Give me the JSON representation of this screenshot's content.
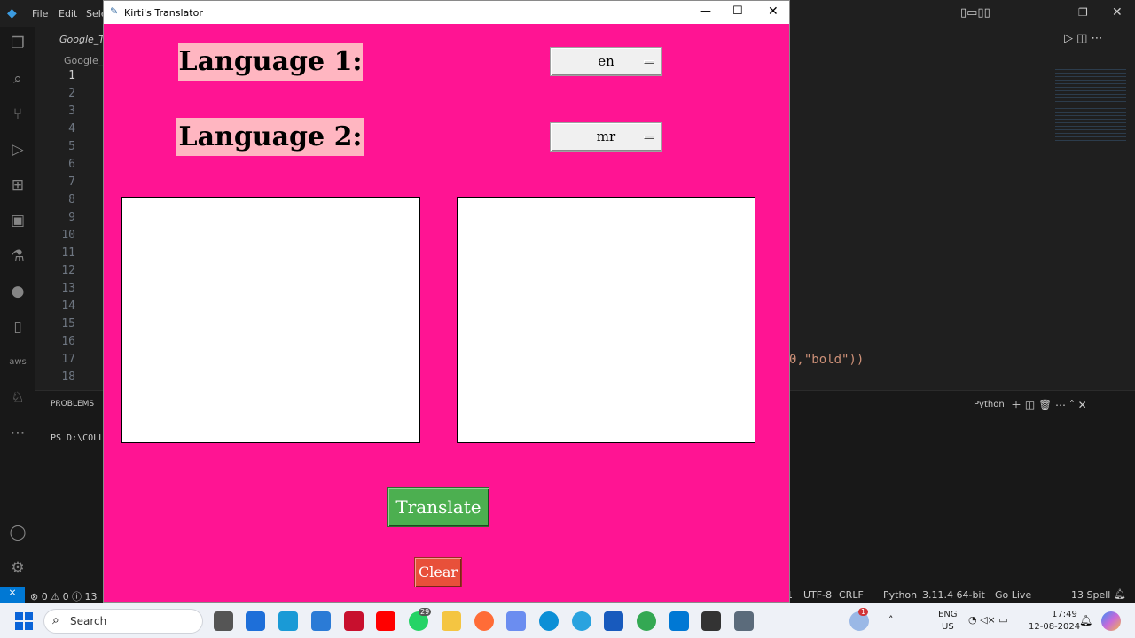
{
  "vscode": {
    "menu": [
      "File",
      "Edit",
      "Sele"
    ],
    "tab1": "Google_Tra",
    "tab2": "Google_Tr",
    "line_numbers": [
      "1",
      "2",
      "3",
      "4",
      "5",
      "6",
      "7",
      "8",
      "9",
      "10",
      "11",
      "12",
      "13",
      "14",
      "15",
      "16",
      "17",
      "18"
    ],
    "code_snippet": "0,\"bold\"))",
    "panel_tab": "PROBLEMS",
    "terminal_prompt": "PS D:\\COLL",
    "terminal_label": "Python",
    "status_left": "⊗ 0 ⚠ 0 ⓘ 13",
    "status_right": [
      "1",
      "UTF-8",
      "CRLF",
      "Python",
      "3.11.4 64-bit",
      "Go Live",
      "13 Spell"
    ]
  },
  "translator": {
    "window_title": "Kirti's Translator",
    "language1_label": "Language 1:",
    "language2_label": "Language 2:",
    "language1_value": "en",
    "language2_value": "mr",
    "translate_label": "Translate",
    "clear_label": "Clear",
    "colors": {
      "background": "#ff1493",
      "label_bg": "#ffb6c1",
      "translate_bg": "#4caf50",
      "clear_bg": "#e8503a"
    }
  },
  "taskbar": {
    "search_placeholder": "Search",
    "lang_line1": "ENG",
    "lang_line2": "US",
    "time": "17:49",
    "date": "12-08-2024",
    "whatsapp_badge": "29",
    "weather_badge": "1"
  }
}
